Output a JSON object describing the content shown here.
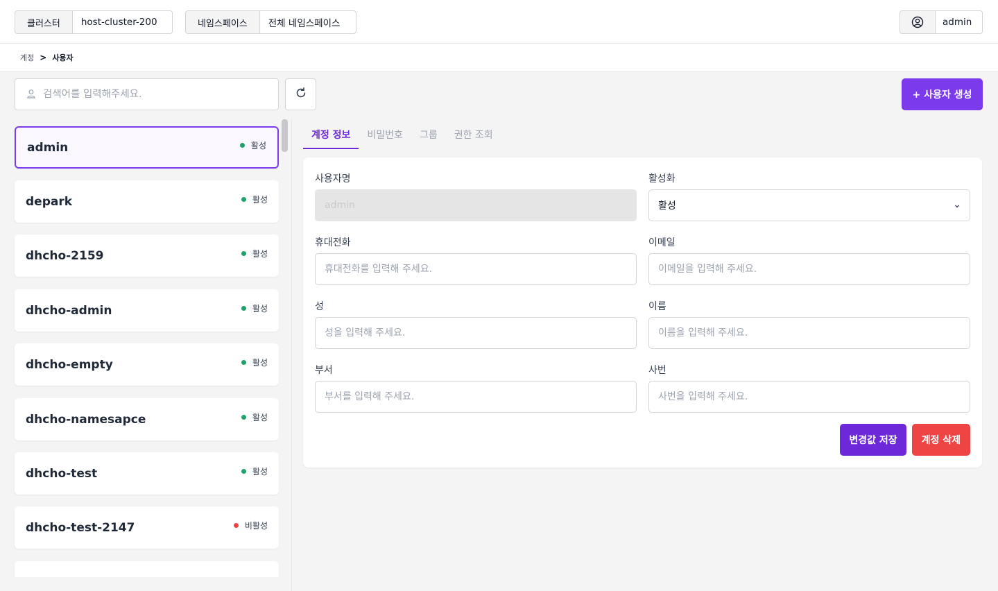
{
  "header": {
    "cluster_label": "클러스터",
    "cluster_value": "host-cluster-200",
    "namespace_label": "네임스페이스",
    "namespace_value": "전체 네임스페이스",
    "user_icon": "user-circle-icon",
    "user_name": "admin"
  },
  "breadcrumb": {
    "parent": "계정",
    "separator": ">",
    "current": "사용자"
  },
  "search": {
    "icon": "user-search-icon",
    "placeholder": "검색어를 입력해주세요."
  },
  "refresh_icon": "refresh-icon",
  "create_button": "+ 사용자 생성",
  "users": [
    {
      "name": "admin",
      "status": "활성",
      "active": true,
      "selected": true
    },
    {
      "name": "depark",
      "status": "활성",
      "active": true
    },
    {
      "name": "dhcho-2159",
      "status": "활성",
      "active": true
    },
    {
      "name": "dhcho-admin",
      "status": "활성",
      "active": true
    },
    {
      "name": "dhcho-empty",
      "status": "활성",
      "active": true
    },
    {
      "name": "dhcho-namesapce",
      "status": "활성",
      "active": true
    },
    {
      "name": "dhcho-test",
      "status": "활성",
      "active": true
    },
    {
      "name": "dhcho-test-2147",
      "status": "비활성",
      "active": false
    }
  ],
  "colors": {
    "accent": "#7c3aed",
    "active_dot": "#22a06b",
    "inactive_dot": "#ef4444",
    "danger": "#ef4444"
  },
  "tabs": [
    "계정 정보",
    "비밀번호",
    "그룹",
    "권한 조회"
  ],
  "form": {
    "username_label": "사용자명",
    "username_value": "admin",
    "activation_label": "활성화",
    "activation_value": "활성",
    "phone_label": "휴대전화",
    "phone_placeholder": "휴대전화를 입력해 주세요.",
    "email_label": "이메일",
    "email_placeholder": "이메일을 입력해 주세요.",
    "last_name_label": "성",
    "last_name_placeholder": "성을 입력해 주세요.",
    "first_name_label": "이름",
    "first_name_placeholder": "이름을 입력해 주세요.",
    "department_label": "부서",
    "department_placeholder": "부서를 입력해 주세요.",
    "employee_id_label": "사번",
    "employee_id_placeholder": "사번을 입력해 주세요.",
    "save_button": "변경값 저장",
    "delete_button": "계정 삭제"
  }
}
